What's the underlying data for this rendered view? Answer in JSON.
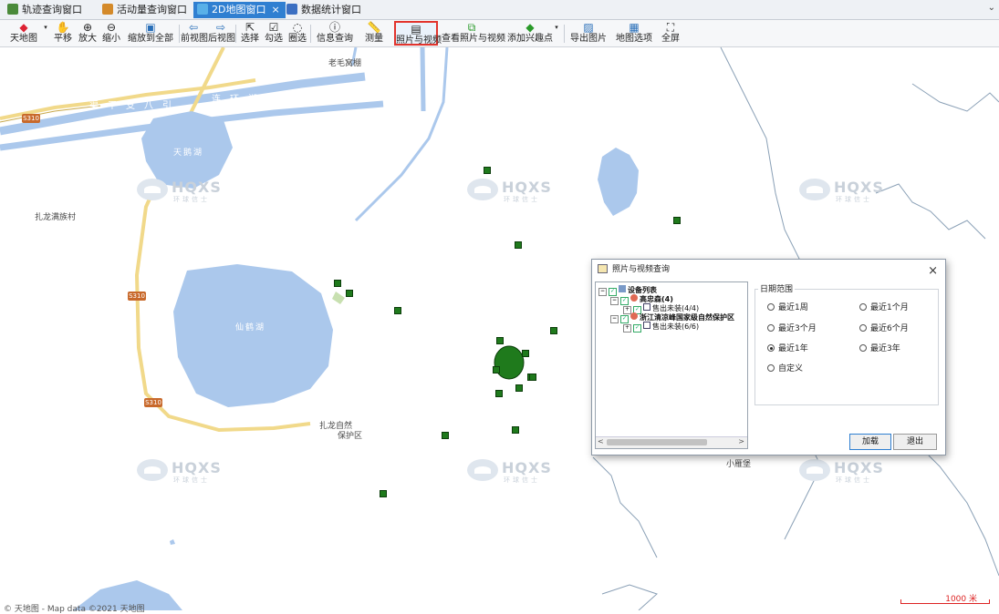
{
  "tabs": [
    {
      "label": "轨迹查询窗口",
      "active": false,
      "icon": "track-icon",
      "color": "#4a8a3a"
    },
    {
      "label": "活动量查询窗口",
      "active": false,
      "icon": "activity-icon",
      "color": "#d48a2a"
    },
    {
      "label": "2D地图窗口",
      "active": true,
      "icon": "map-icon",
      "color": "#59b0e8",
      "close": "×"
    },
    {
      "label": "数据统计窗口",
      "active": false,
      "icon": "stats-icon",
      "color": "#3b6fc2"
    }
  ],
  "tab_overflow": "⌄",
  "toolbar": {
    "tianditu": "天地图",
    "pan": "平移",
    "zoom_in": "放大",
    "zoom_out": "缩小",
    "zoom_all": "缩放到全部",
    "prev_view": "前视图",
    "next_view": "后视图",
    "select": "选择",
    "check_select": "勾选",
    "circle_select": "圈选",
    "info_query": "信息查询",
    "measure": "测量",
    "photo_video": "照片与视频",
    "view_photo_video": "查看照片与视频",
    "add_poi": "添加兴趣点",
    "export_image": "导出图片",
    "map_options": "地图选项",
    "fullscreen": "全屏"
  },
  "map": {
    "labels": {
      "laomao": "老毛窝棚",
      "zhalong_village": "扎龙满族村",
      "reserve_line1": "扎龙自然",
      "reserve_line2": "保护区",
      "xiaoyanpu": "小雁堡",
      "canal": "渠干支八引",
      "canal2": "连环湖铝干",
      "lake1": "天鹅湖",
      "lake2": "仙鹤湖",
      "road1": "S310",
      "road2": "S310",
      "road3": "S310"
    },
    "watermark_text": "HQXS",
    "watermark_sub": "环球信士",
    "copyright": "© 天地图 - Map data ©2021 天地图",
    "scale_label": "1000 米"
  },
  "dialog": {
    "title": "照片与视频查询",
    "close": "×",
    "tree": {
      "root": "设备列表",
      "node1": "高忠森(4)",
      "node1_child": "售出未装(4/4)",
      "node2": "浙江清凉峰国家级自然保护区",
      "node2_child": "售出未装(6/6)"
    },
    "date_range_title": "日期范围",
    "options": [
      {
        "label": "最近1周",
        "checked": false
      },
      {
        "label": "最近1个月",
        "checked": false
      },
      {
        "label": "最近3个月",
        "checked": false
      },
      {
        "label": "最近6个月",
        "checked": false
      },
      {
        "label": "最近1年",
        "checked": true
      },
      {
        "label": "最近3年",
        "checked": false
      },
      {
        "label": "自定义",
        "checked": false
      }
    ],
    "load_button": "加载",
    "exit_button": "退出"
  },
  "colors": {
    "water": "#abc8ec",
    "road": "#f1d98a",
    "marker": "#1f7a1c",
    "active_tab": "#2f7fd1",
    "selected_tool_border": "#e2342d"
  }
}
